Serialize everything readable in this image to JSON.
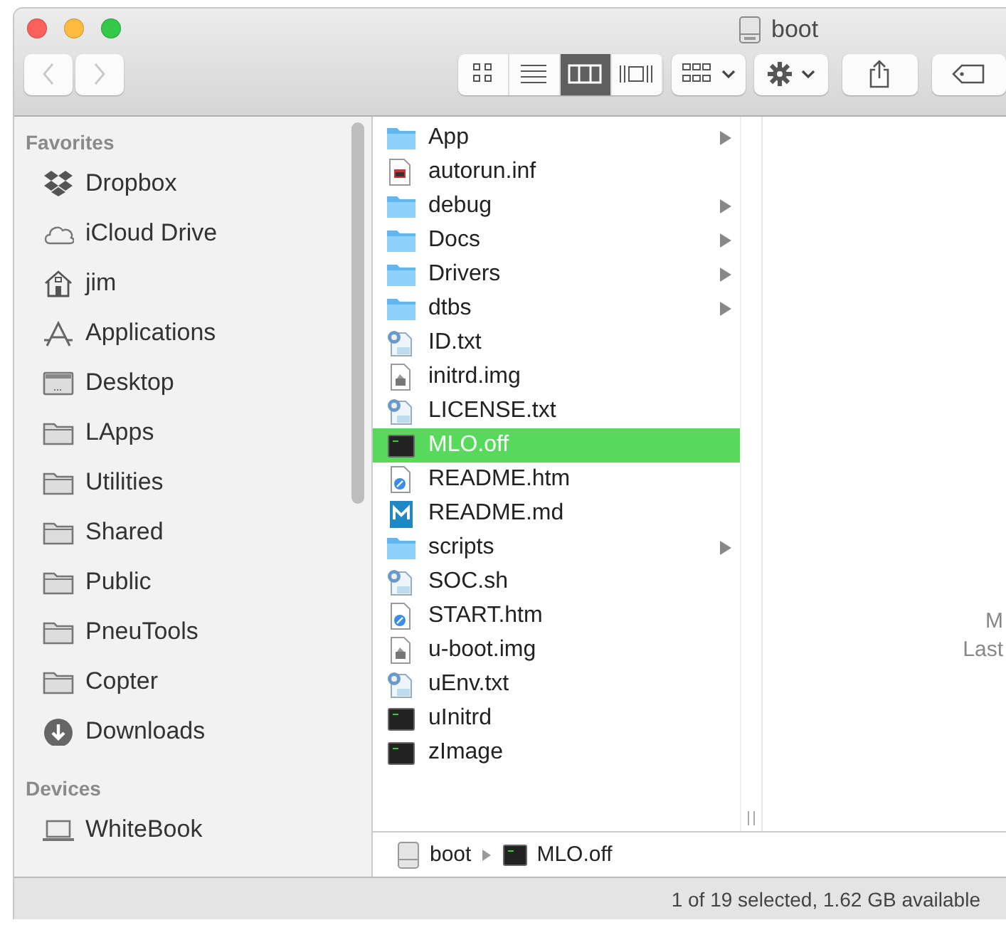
{
  "window": {
    "title": "boot"
  },
  "toolbar": {
    "back_disabled": true,
    "forward_disabled": true,
    "view_modes": [
      {
        "kind": "icons",
        "selected": false
      },
      {
        "kind": "list",
        "selected": false
      },
      {
        "kind": "columns",
        "selected": true
      },
      {
        "kind": "coverflow",
        "selected": false
      }
    ]
  },
  "sidebar": {
    "sections": [
      {
        "title": "Favorites",
        "items": [
          {
            "label": "Dropbox",
            "kind": "dropbox"
          },
          {
            "label": "iCloud Drive",
            "kind": "cloud"
          },
          {
            "label": "jim",
            "kind": "home"
          },
          {
            "label": "Applications",
            "kind": "apps"
          },
          {
            "label": "Desktop",
            "kind": "desktop"
          },
          {
            "label": "LApps",
            "kind": "folder"
          },
          {
            "label": "Utilities",
            "kind": "folder"
          },
          {
            "label": "Shared",
            "kind": "folder"
          },
          {
            "label": "Public",
            "kind": "folder"
          },
          {
            "label": "PneuTools",
            "kind": "folder"
          },
          {
            "label": "Copter",
            "kind": "folder"
          },
          {
            "label": "Downloads",
            "kind": "downloads"
          }
        ]
      },
      {
        "title": "Devices",
        "items": [
          {
            "label": "WhiteBook",
            "kind": "laptop"
          }
        ]
      }
    ]
  },
  "files": [
    {
      "name": "App",
      "kind": "folder",
      "selected": false
    },
    {
      "name": "autorun.inf",
      "kind": "inf",
      "selected": false
    },
    {
      "name": "debug",
      "kind": "folder",
      "selected": false
    },
    {
      "name": "Docs",
      "kind": "folder",
      "selected": false
    },
    {
      "name": "Drivers",
      "kind": "folder",
      "selected": false
    },
    {
      "name": "dtbs",
      "kind": "folder",
      "selected": false
    },
    {
      "name": "ID.txt",
      "kind": "script",
      "selected": false
    },
    {
      "name": "initrd.img",
      "kind": "image",
      "selected": false
    },
    {
      "name": "LICENSE.txt",
      "kind": "script",
      "selected": false
    },
    {
      "name": "MLO.off",
      "kind": "terminal",
      "selected": true
    },
    {
      "name": "README.htm",
      "kind": "html",
      "selected": false
    },
    {
      "name": "README.md",
      "kind": "markdown",
      "selected": false
    },
    {
      "name": "scripts",
      "kind": "folder",
      "selected": false
    },
    {
      "name": "SOC.sh",
      "kind": "script",
      "selected": false
    },
    {
      "name": "START.htm",
      "kind": "html",
      "selected": false
    },
    {
      "name": "u-boot.img",
      "kind": "image",
      "selected": false
    },
    {
      "name": "uEnv.txt",
      "kind": "script",
      "selected": false
    },
    {
      "name": "uInitrd",
      "kind": "terminal",
      "selected": false
    },
    {
      "name": "zImage",
      "kind": "terminal",
      "selected": false
    }
  ],
  "preview": {
    "lines": [
      "M",
      "Last"
    ]
  },
  "path_bar": [
    {
      "label": "boot",
      "kind": "drive"
    },
    {
      "label": "MLO.off",
      "kind": "terminal"
    }
  ],
  "status_bar": "1 of 19 selected, 1.62 GB available"
}
